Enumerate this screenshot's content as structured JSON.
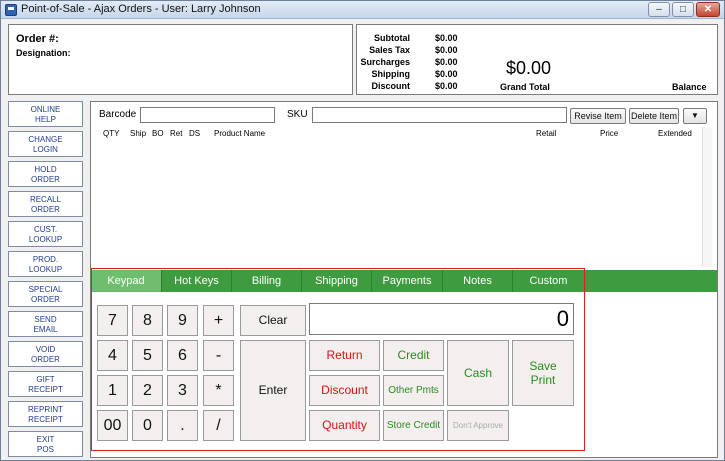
{
  "window": {
    "title": "Point-of-Sale - Ajax Orders - User: Larry Johnson",
    "minimize_glyph": "–",
    "maximize_glyph": "□",
    "close_glyph": "✕"
  },
  "order": {
    "order_label": "Order #:",
    "designation_label": "Designation:"
  },
  "totals": {
    "rows": [
      {
        "label": "Subtotal",
        "value": "$0.00"
      },
      {
        "label": "Sales Tax",
        "value": "$0.00"
      },
      {
        "label": "Surcharges",
        "value": "$0.00"
      },
      {
        "label": "Shipping",
        "value": "$0.00"
      },
      {
        "label": "Discount",
        "value": "$0.00"
      }
    ],
    "grand_total_value": "$0.00",
    "grand_total_label": "Grand Total",
    "balance_label": "Balance"
  },
  "sidebar": [
    {
      "line1": "ONLINE",
      "line2": "HELP"
    },
    {
      "line1": "CHANGE",
      "line2": "LOGIN"
    },
    {
      "line1": "HOLD",
      "line2": "ORDER"
    },
    {
      "line1": "RECALL",
      "line2": "ORDER"
    },
    {
      "line1": "CUST.",
      "line2": "LOOKUP"
    },
    {
      "line1": "PROD.",
      "line2": "LOOKUP"
    },
    {
      "line1": "SPECIAL",
      "line2": "ORDER"
    },
    {
      "line1": "SEND",
      "line2": "EMAIL"
    },
    {
      "line1": "VOID",
      "line2": "ORDER"
    },
    {
      "line1": "GIFT",
      "line2": "RECEIPT"
    },
    {
      "line1": "REPRINT",
      "line2": "RECEIPT"
    },
    {
      "line1": "EXIT",
      "line2": "POS"
    }
  ],
  "entry": {
    "barcode_label": "Barcode",
    "barcode_value": "",
    "sku_label": "SKU",
    "sku_value": "",
    "revise_item": "Revise Item",
    "delete_item": "Delete Item",
    "dropdown_glyph": "▼"
  },
  "columns": {
    "qty": "QTY",
    "ship": "Ship",
    "bo": "BO",
    "ret": "Ret",
    "ds": "DS",
    "product_name": "Product Name",
    "retail": "Retail",
    "price": "Price",
    "extended": "Extended"
  },
  "tabs": [
    "Keypad",
    "Hot Keys",
    "Billing",
    "Shipping",
    "Payments",
    "Notes",
    "Custom"
  ],
  "keypad": {
    "numbers": [
      "7",
      "8",
      "9",
      "4",
      "5",
      "6",
      "1",
      "2",
      "3",
      "00",
      "0",
      "."
    ],
    "operators": [
      "+",
      "-",
      "*",
      "/"
    ],
    "clear": "Clear",
    "enter": "Enter",
    "display_value": "0",
    "return": "Return",
    "discount": "Discount",
    "quantity": "Quantity",
    "credit": "Credit",
    "other_pmts": "Other Pmts",
    "store_credit": "Store Credit",
    "cash": "Cash",
    "save": "Save",
    "print": "Print",
    "dont_approve": "Don't Approve"
  },
  "colors": {
    "tab_green": "#3f9b3f",
    "tab_active": "#6fbe6f",
    "keypad_outline": "#e02020",
    "action_red": "#d11111",
    "action_green": "#2b8a1f",
    "sidebar_text": "#1f3d8c"
  }
}
